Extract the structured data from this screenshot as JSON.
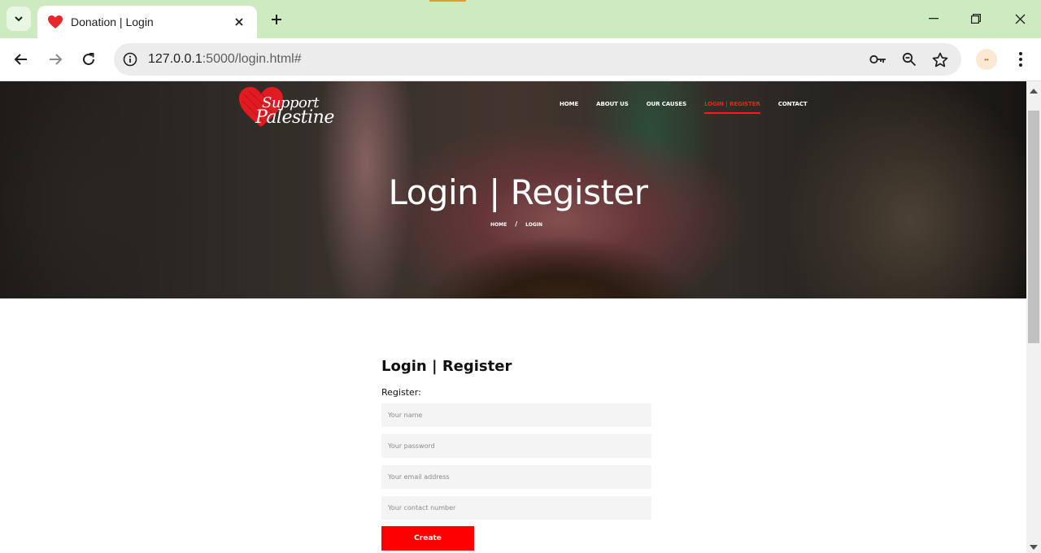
{
  "browser": {
    "tab_title": "Donation | Login",
    "url_host": "127.0.0.1",
    "url_rest": ":5000/login.html#",
    "extension_label": "••"
  },
  "site": {
    "logo_line1": "Support",
    "logo_line2": "Palestine",
    "nav": [
      {
        "label": "HOME"
      },
      {
        "label": "ABOUT US"
      },
      {
        "label": "OUR CAUSES"
      },
      {
        "label": "LOGIN | REGISTER"
      },
      {
        "label": "CONTACT"
      }
    ],
    "hero_title": "Login | Register",
    "breadcrumb_home": "HOME",
    "breadcrumb_sep": "/",
    "breadcrumb_current": "LOGIN"
  },
  "form": {
    "title": "Login | Register",
    "subtitle": "Register:",
    "name_placeholder": "Your name",
    "password_placeholder": "Your password",
    "email_placeholder": "Your email address",
    "contact_placeholder": "Your contact number",
    "submit_label": "Create"
  },
  "colors": {
    "accent": "#ff0000",
    "tab_strip": "#cdeac0"
  }
}
